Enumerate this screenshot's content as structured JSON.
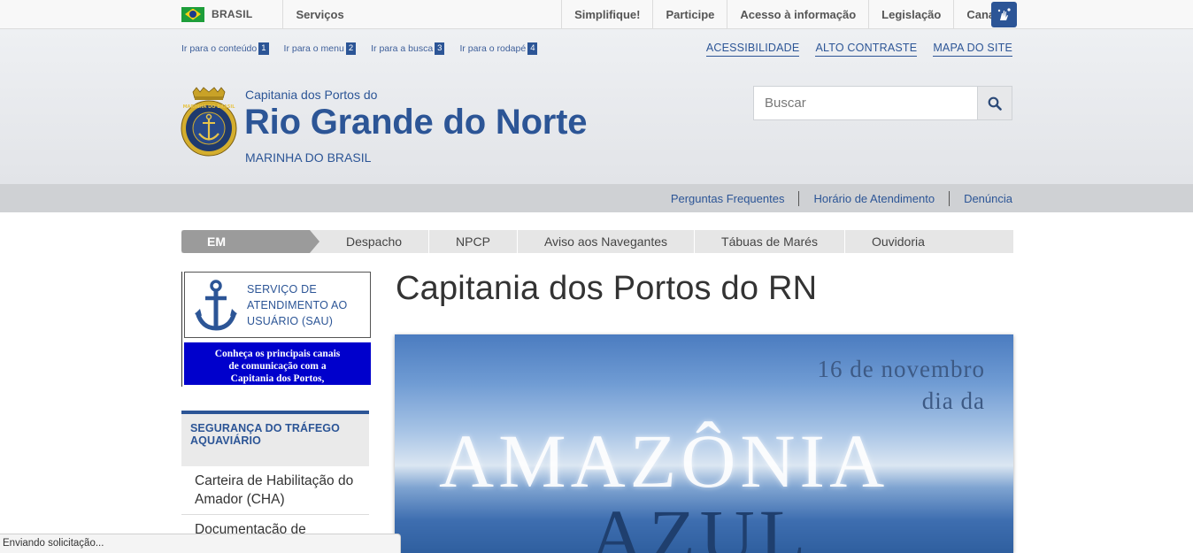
{
  "govbar": {
    "country": "BRASIL",
    "servicos": "Serviços",
    "links": [
      "Simplifique!",
      "Participe",
      "Acesso à informação",
      "Legislação",
      "Canais"
    ],
    "accessibility_icon": "vlibras-hands-icon"
  },
  "skip_links": [
    {
      "label": "Ir para o conteúdo",
      "num": "1"
    },
    {
      "label": "Ir para o menu",
      "num": "2"
    },
    {
      "label": "Ir para a busca",
      "num": "3"
    },
    {
      "label": "Ir para o rodapé",
      "num": "4"
    }
  ],
  "top_links": [
    "ACESSIBILIDADE",
    "ALTO CONTRASTE",
    "MAPA DO SITE"
  ],
  "header": {
    "pre_title": "Capitania dos Portos do",
    "title": "Rio Grande do Norte",
    "subtitle": "MARINHA DO BRASIL",
    "logo_icon": "marinha-do-brasil-crest-icon"
  },
  "search": {
    "placeholder": "Buscar",
    "value": "",
    "icon": "search-icon"
  },
  "service_links": [
    "Perguntas Frequentes",
    "Horário de Atendimento",
    "Denúncia"
  ],
  "destaque": {
    "label": "EM DESTAQUE",
    "items": [
      "Despacho",
      "NPCP",
      "Aviso aos Navegantes",
      "Tábuas de Marés",
      "Ouvidoria"
    ]
  },
  "sidebar": {
    "sau_text": "SERVIÇO DE ATENDIMENTO AO USUÁRIO (SAU)",
    "canais_lines": [
      "Conheça os principais canais",
      "de comunicação com a",
      "Capitania dos Portos,"
    ],
    "menu_title": "SEGURANÇA DO TRÁFEGO AQUAVIÁRIO",
    "menu_items": [
      "Carteira de Habilitação do Amador (CHA)",
      "Documentação de"
    ]
  },
  "main": {
    "title": "Capitania dos Portos do RN",
    "banner": {
      "line1": "16 de novembro",
      "line2": "dia da",
      "line3": "AMAZÔNIA",
      "line4": "AZUL"
    }
  },
  "status_bar": "Enviando solicitação...",
  "colors": {
    "brand_blue": "#2c5596",
    "canais_blue": "#0000cc",
    "destaque_gray": "#9b9b9b"
  }
}
